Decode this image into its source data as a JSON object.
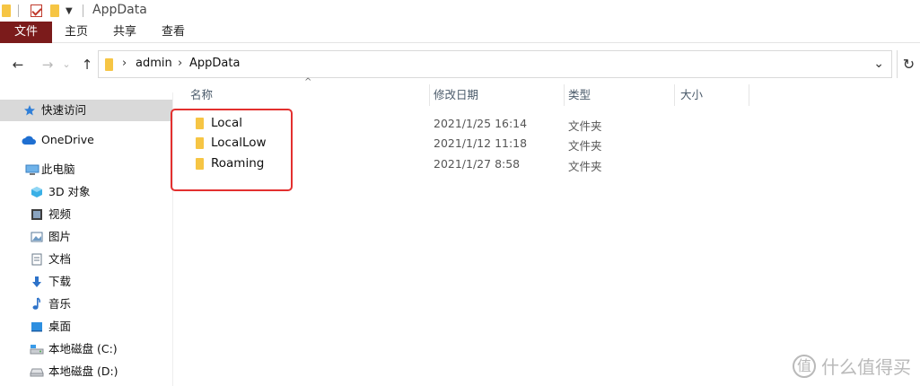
{
  "window": {
    "title": "AppData"
  },
  "ribbon": {
    "tabs": [
      "文件",
      "主页",
      "共享",
      "查看"
    ]
  },
  "nav": {
    "back": "←",
    "forward": "→",
    "up": "↑",
    "refresh": "↻",
    "dropdown": "⌄"
  },
  "address": {
    "segments": [
      "admin",
      "AppData"
    ]
  },
  "sidebar": {
    "items": [
      {
        "label": "快速访问",
        "icon": "star-icon"
      },
      {
        "label": "OneDrive",
        "icon": "cloud-icon"
      },
      {
        "label": "此电脑",
        "icon": "computer-icon"
      },
      {
        "label": "3D 对象",
        "icon": "cube-icon"
      },
      {
        "label": "视频",
        "icon": "video-icon"
      },
      {
        "label": "图片",
        "icon": "picture-icon"
      },
      {
        "label": "文档",
        "icon": "document-icon"
      },
      {
        "label": "下载",
        "icon": "download-icon"
      },
      {
        "label": "音乐",
        "icon": "music-icon"
      },
      {
        "label": "桌面",
        "icon": "desktop-icon"
      },
      {
        "label": "本地磁盘 (C:)",
        "icon": "drive-icon"
      },
      {
        "label": "本地磁盘 (D:)",
        "icon": "drive-icon"
      }
    ]
  },
  "columns": {
    "name": "名称",
    "modified": "修改日期",
    "type": "类型",
    "size": "大小"
  },
  "files": [
    {
      "name": "Local",
      "modified": "2021/1/25 16:14",
      "type": "文件夹"
    },
    {
      "name": "LocalLow",
      "modified": "2021/1/12 11:18",
      "type": "文件夹"
    },
    {
      "name": "Roaming",
      "modified": "2021/1/27 8:58",
      "type": "文件夹"
    }
  ],
  "watermark": {
    "logo": "值",
    "text": "什么值得买"
  },
  "colors": {
    "file_tab": "#7b1b1b",
    "folder": "#f6c544",
    "highlight": "#e3302f"
  }
}
